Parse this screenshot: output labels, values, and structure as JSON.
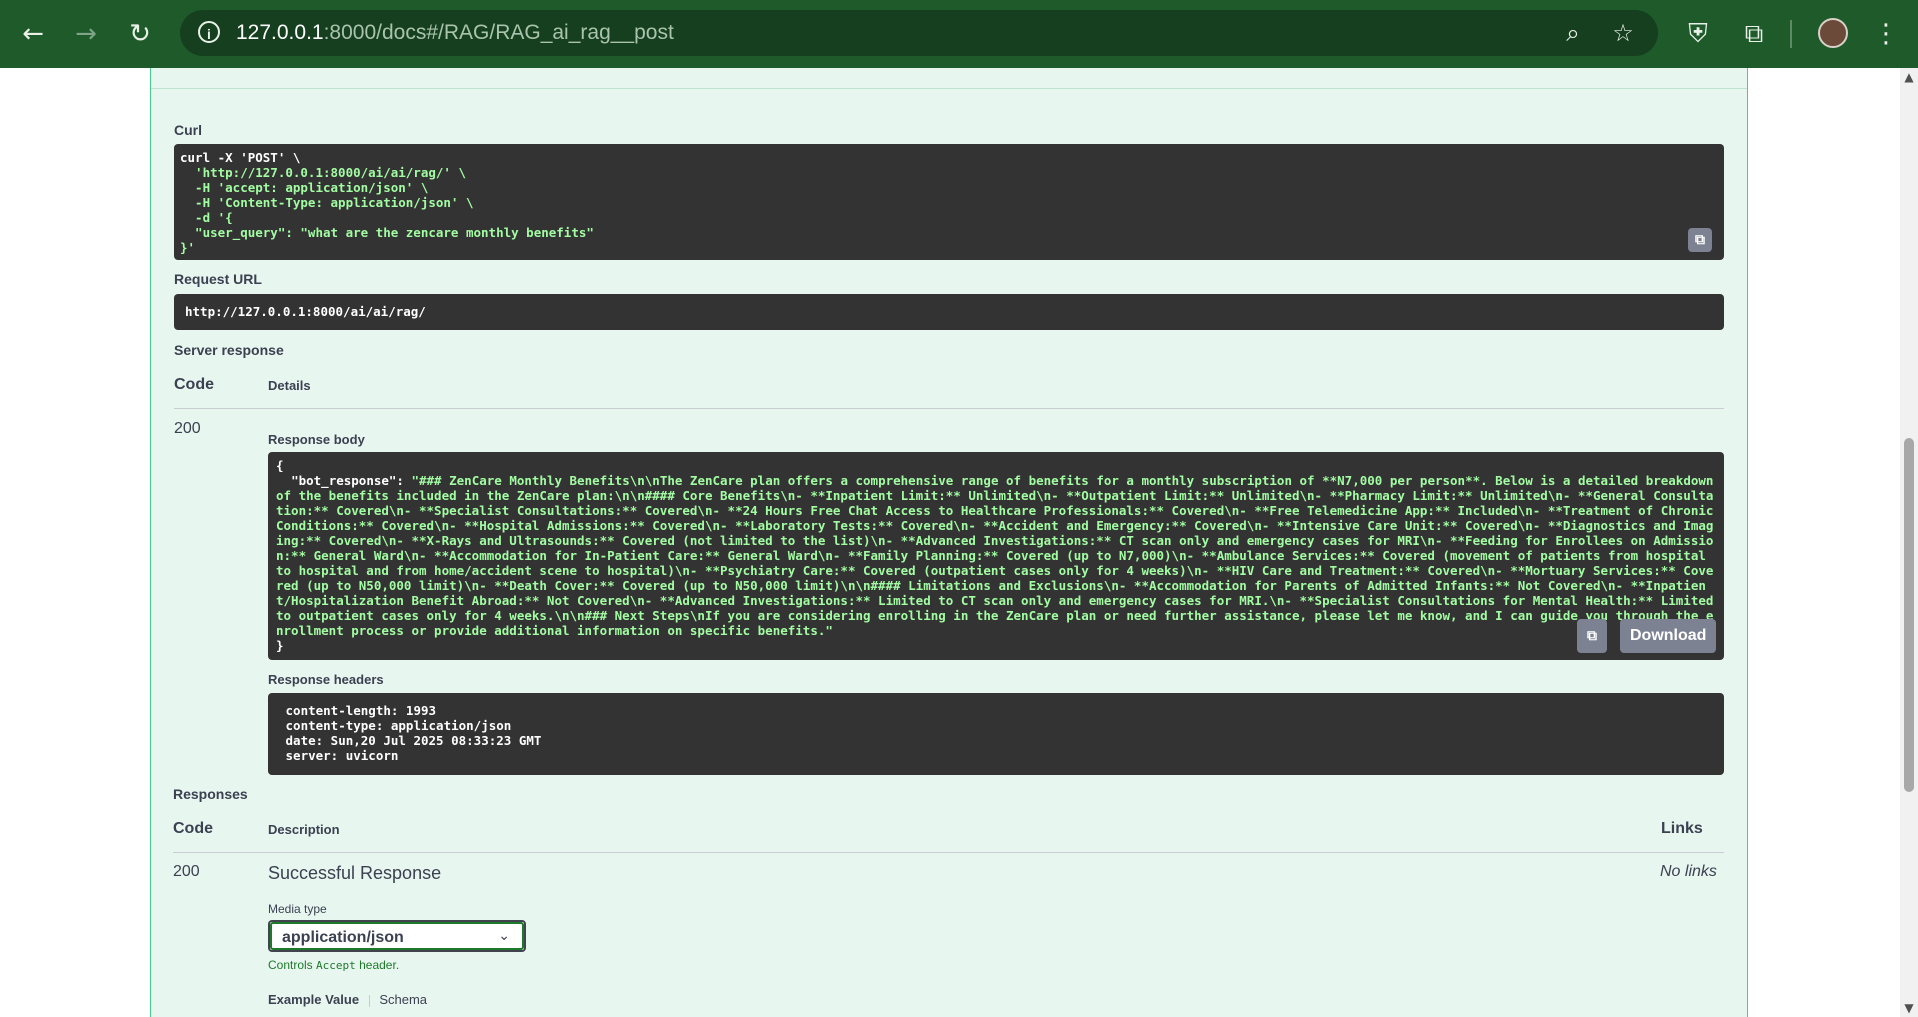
{
  "browser": {
    "url_host": "127.0.0.1",
    "url_rest": ":8000/docs#/RAG/RAG_ai_rag__post",
    "icons": {
      "back": "arrow-left-icon",
      "forward": "arrow-right-icon",
      "reload": "reload-icon",
      "info": "info-icon",
      "zoom": "zoom-icon",
      "bookmark": "star-icon",
      "shield": "shield-extension-icon",
      "extensions": "puzzle-icon",
      "menu": "kebab-menu-icon"
    },
    "colors": {
      "frame": "#1e5a2a",
      "omnibox": "#153f1e"
    }
  },
  "curl": {
    "label": "Curl",
    "lines": [
      "curl -X 'POST' \\",
      "  'http://127.0.0.1:8000/ai/ai/rag/' \\",
      "  -H 'accept: application/json' \\",
      "  -H 'Content-Type: application/json' \\",
      "  -d '{",
      "  \"user_query\": \"what are the zencare monthly benefits\"",
      "}'"
    ]
  },
  "request_url": {
    "label": "Request URL",
    "value": "http://127.0.0.1:8000/ai/ai/rag/"
  },
  "server_response": {
    "label": "Server response",
    "col_code": "Code",
    "col_details": "Details",
    "code": "200",
    "body_label": "Response body",
    "body_open": "{",
    "body_key": "  \"bot_response\": ",
    "body_value": "\"### ZenCare Monthly Benefits\\n\\nThe ZenCare plan offers a comprehensive range of benefits for a monthly subscription of **N7,000 per person**. Below is a detailed breakdown of the benefits included in the ZenCare plan:\\n\\n#### Core Benefits\\n- **Inpatient Limit:** Unlimited\\n- **Outpatient Limit:** Unlimited\\n- **Pharmacy Limit:** Unlimited\\n- **General Consultation:** Covered\\n- **Specialist Consultations:** Covered\\n- **24 Hours Free Chat Access to Healthcare Professionals:** Covered\\n- **Free Telemedicine App:** Included\\n- **Treatment of Chronic Conditions:** Covered\\n- **Hospital Admissions:** Covered\\n- **Laboratory Tests:** Covered\\n- **Accident and Emergency:** Covered\\n- **Intensive Care Unit:** Covered\\n- **Diagnostics and Imaging:** Covered\\n- **X-Rays and Ultrasounds:** Covered (not limited to the list)\\n- **Advanced Investigations:** CT scan only and emergency cases for MRI\\n- **Feeding for Enrollees on Admission:** General Ward\\n- **Accommodation for In-Patient Care:** General Ward\\n- **Family Planning:** Covered (up to N7,000)\\n- **Ambulance Services:** Covered (movement of patients from hospital to hospital and from home/accident scene to hospital)\\n- **Psychiatry Care:** Covered (outpatient cases only for 4 weeks)\\n- **HIV Care and Treatment:** Covered\\n- **Mortuary Services:** Covered (up to N50,000 limit)\\n- **Death Cover:** Covered (up to N50,000 limit)\\n\\n#### Limitations and Exclusions\\n- **Accommodation for Parents of Admitted Infants:** Not Covered\\n- **Inpatient/Hospitalization Benefit Abroad:** Not Covered\\n- **Advanced Investigations:** Limited to CT scan only and emergency cases for MRI.\\n- **Specialist Consultations for Mental Health:** Limited to outpatient cases only for 4 weeks.\\n\\n### Next Steps\\nIf you are considering enrolling in the ZenCare plan or need further assistance, please let me know, and I can guide you through the enrollment process or provide additional information on specific benefits.\"",
    "body_close": "}",
    "download_label": "Download",
    "headers_label": "Response headers",
    "headers": [
      " content-length: 1993 ",
      " content-type: application/json ",
      " date: Sun,20 Jul 2025 08:33:23 GMT ",
      " server: uvicorn "
    ]
  },
  "responses": {
    "label": "Responses",
    "col_code": "Code",
    "col_description": "Description",
    "col_links": "Links",
    "code": "200",
    "description": "Successful Response",
    "links": "No links",
    "media_type_label": "Media type",
    "media_type_value": "application/json",
    "controls_prefix": "Controls ",
    "controls_code": "Accept",
    "controls_suffix": " header.",
    "example_tab": "Example Value",
    "schema_tab": "Schema"
  },
  "colors": {
    "post_bg": "#e8f6f0",
    "post_border": "#49cc90",
    "code_bg": "#333333",
    "json_text": "#a2fca2",
    "text": "#3b4151"
  }
}
